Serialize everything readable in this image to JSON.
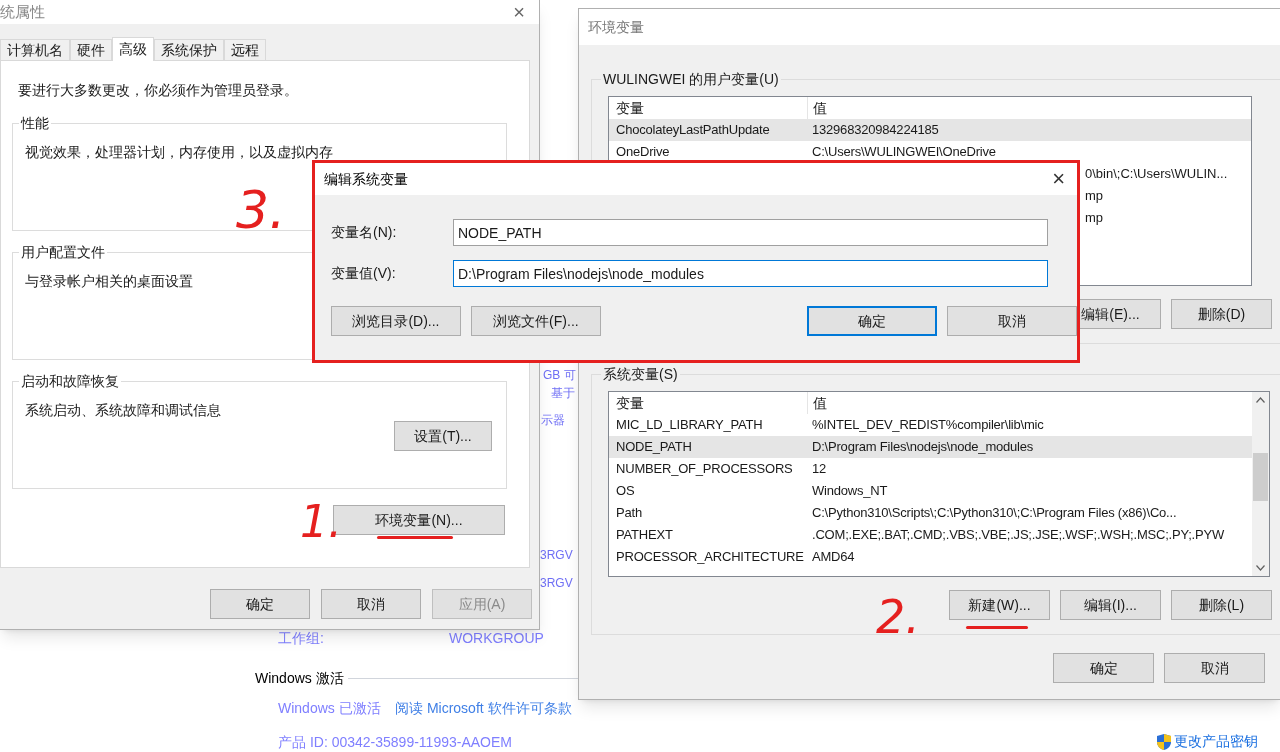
{
  "background_page": {
    "fragments": [
      "GB 可",
      "基于",
      "示器",
      "3RGV",
      "3RGV"
    ],
    "workgroup_label": "工作组:",
    "workgroup_value": "WORKGROUP",
    "activation_heading": "Windows 激活",
    "activation_status": "Windows 已激活",
    "license_link": "阅读 Microsoft 软件许可条款",
    "product_id": "产品 ID: 00342-35899-11993-AAOEM",
    "change_key_link": "更改产品密钥"
  },
  "system_properties": {
    "title": "统属性",
    "close": "×",
    "tabs": [
      {
        "label": "计算机名",
        "selected": false
      },
      {
        "label": "硬件",
        "selected": false
      },
      {
        "label": "高级",
        "selected": true
      },
      {
        "label": "系统保护",
        "selected": false
      },
      {
        "label": "远程",
        "selected": false
      }
    ],
    "notice": "要进行大多数更改，你必须作为管理员登录。",
    "groups": [
      {
        "title": "性能",
        "description": "视觉效果，处理器计划，内存使用，以及虚拟内存"
      },
      {
        "title": "用户配置文件",
        "description": "与登录帐户相关的桌面设置"
      },
      {
        "title": "启动和故障恢复",
        "description": "系统启动、系统故障和调试信息",
        "button": "设置(T)..."
      }
    ],
    "env_button": "环境变量(N)...",
    "buttons": [
      {
        "label": "确定",
        "disabled": false
      },
      {
        "label": "取消",
        "disabled": false
      },
      {
        "label": "应用(A)",
        "disabled": true
      }
    ]
  },
  "environment_variables": {
    "title": "环境变量",
    "user_group": {
      "title": "WULINGWEI 的用户变量(U)",
      "columns": [
        "变量",
        "值"
      ],
      "rows": [
        {
          "kind": "full",
          "name": "ChocolateyLastPathUpdate",
          "value": "132968320984224185",
          "selected": true
        },
        {
          "kind": "full",
          "name": "OneDrive",
          "value": "C:\\Users\\WULINGWEI\\OneDrive",
          "selected": false
        },
        {
          "kind": "partial",
          "value": "0\\bin\\;C:\\Users\\WULIN...",
          "selected": false
        },
        {
          "kind": "partial",
          "value": "mp",
          "selected": false
        },
        {
          "kind": "partial",
          "value": "mp",
          "selected": false
        }
      ],
      "buttons": [
        "编辑(E)...",
        "删除(D)"
      ]
    },
    "system_group": {
      "title": "系统变量(S)",
      "columns": [
        "变量",
        "值"
      ],
      "rows": [
        {
          "kind": "full",
          "name": "MIC_LD_LIBRARY_PATH",
          "value": "%INTEL_DEV_REDIST%compiler\\lib\\mic",
          "selected": false
        },
        {
          "kind": "full",
          "name": "NODE_PATH",
          "value": "D:\\Program Files\\nodejs\\node_modules",
          "selected": true
        },
        {
          "kind": "full",
          "name": "NUMBER_OF_PROCESSORS",
          "value": "12",
          "selected": false
        },
        {
          "kind": "full",
          "name": "OS",
          "value": "Windows_NT",
          "selected": false
        },
        {
          "kind": "full",
          "name": "Path",
          "value": "C:\\Python310\\Scripts\\;C:\\Python310\\;C:\\Program Files (x86)\\Co...",
          "selected": false
        },
        {
          "kind": "full",
          "name": "PATHEXT",
          "value": ".COM;.EXE;.BAT;.CMD;.VBS;.VBE;.JS;.JSE;.WSF;.WSH;.MSC;.PY;.PYW",
          "selected": false
        },
        {
          "kind": "full",
          "name": "PROCESSOR_ARCHITECTURE",
          "value": "AMD64",
          "selected": false
        }
      ],
      "buttons": [
        "新建(W)...",
        "编辑(I)...",
        "删除(L)"
      ]
    },
    "buttons": [
      "确定",
      "取消"
    ]
  },
  "edit_dialog": {
    "title": "编辑系统变量",
    "close": "×",
    "fields": [
      {
        "label": "变量名(N):",
        "value": "NODE_PATH",
        "focused": false
      },
      {
        "label": "变量值(V):",
        "value": "D:\\Program Files\\nodejs\\node_modules",
        "focused": true
      }
    ],
    "buttons": [
      {
        "label": "浏览目录(D)...",
        "default": false
      },
      {
        "label": "浏览文件(F)...",
        "default": false
      },
      {
        "label": "确定",
        "default": true
      },
      {
        "label": "取消",
        "default": false
      }
    ]
  },
  "annotations": [
    {
      "label": "3."
    },
    {
      "label": "1."
    },
    {
      "label": "2."
    }
  ]
}
